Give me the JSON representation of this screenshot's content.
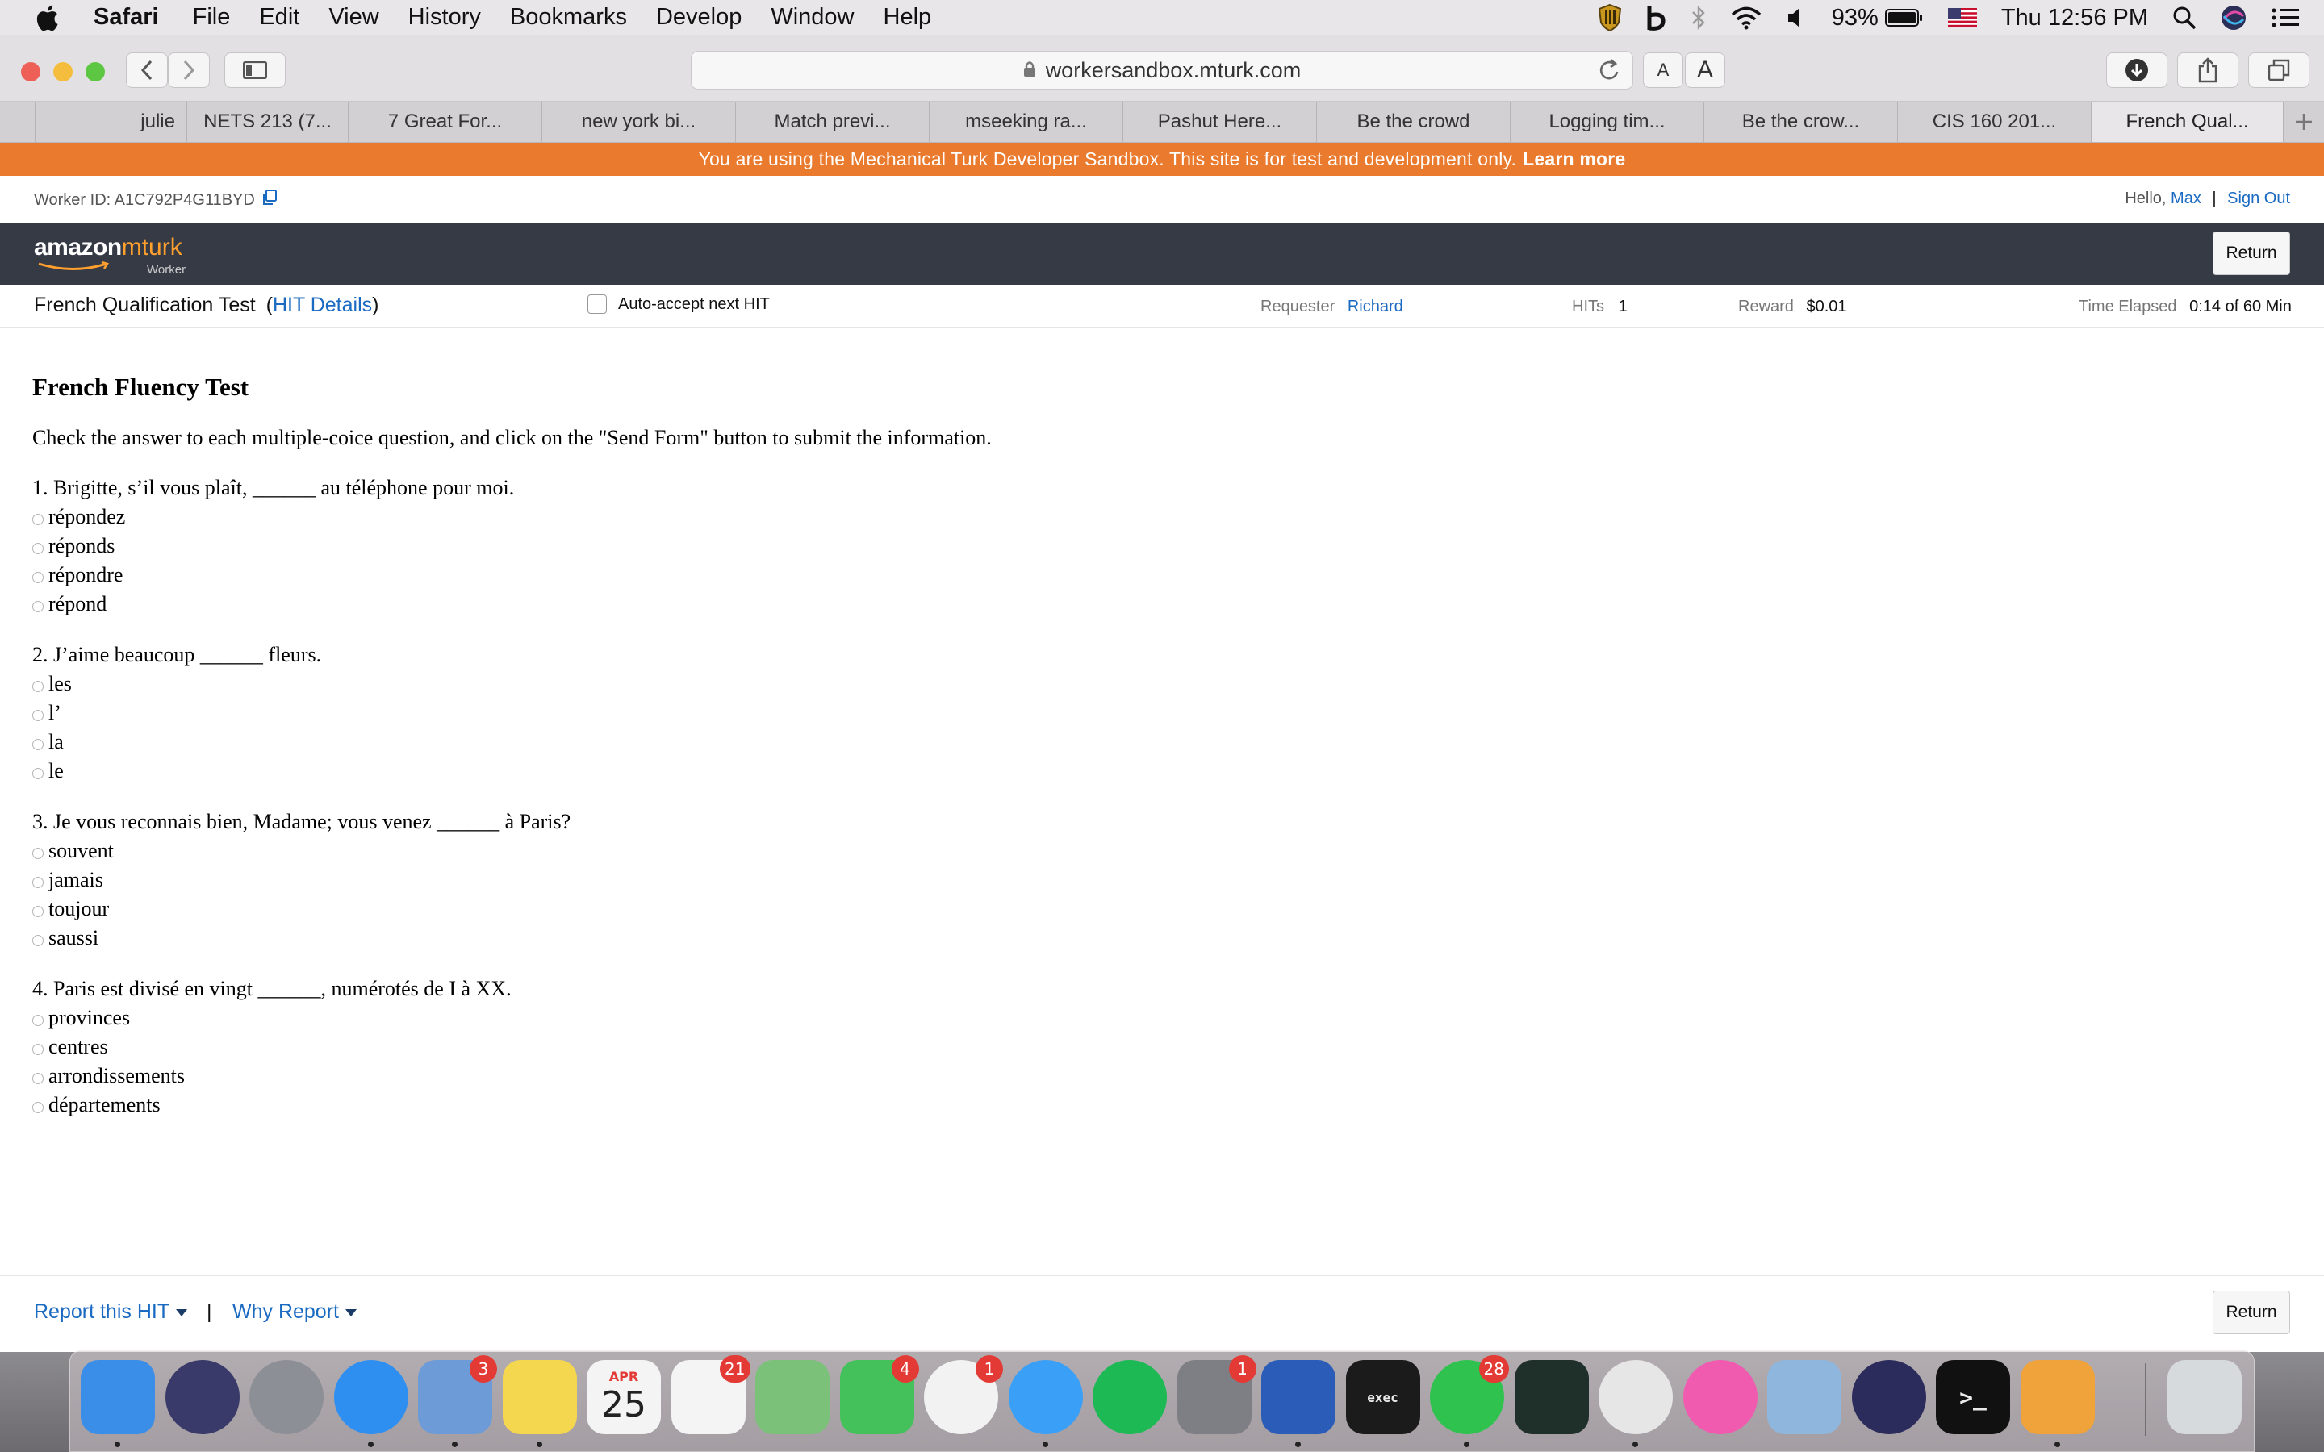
{
  "menubar": {
    "app_name": "Safari",
    "items": [
      "File",
      "Edit",
      "View",
      "History",
      "Bookmarks",
      "Develop",
      "Window",
      "Help"
    ],
    "battery": "93%",
    "clock": "Thu 12:56 PM"
  },
  "toolbar": {
    "url": "workersandbox.mturk.com",
    "font_small": "A",
    "font_large": "A"
  },
  "tabs": [
    {
      "label": "julie"
    },
    {
      "label": "NETS 213 (7..."
    },
    {
      "label": "7 Great For..."
    },
    {
      "label": "new york bi..."
    },
    {
      "label": "Match previ..."
    },
    {
      "label": "mseeking ra..."
    },
    {
      "label": "Pashut Here..."
    },
    {
      "label": "Be the crowd"
    },
    {
      "label": "Logging tim..."
    },
    {
      "label": "Be the crow..."
    },
    {
      "label": "CIS 160 201..."
    },
    {
      "label": "French Qual..."
    }
  ],
  "sandbox_banner": {
    "text": "You are using the Mechanical Turk Developer Sandbox. This site is for test and development only.",
    "link": "Learn more"
  },
  "worker_row": {
    "worker_id": "Worker ID: A1C792P4G11BYD",
    "hello": "Hello,",
    "user": "Max",
    "divider": "|",
    "sign_out": "Sign Out"
  },
  "header": {
    "logo_amazon": "amazon",
    "logo_mturk": "mturk",
    "logo_worker": "Worker",
    "return_label": "Return"
  },
  "hit_bar": {
    "title": "French Qualification Test",
    "details_open": "(",
    "details_link": "HIT Details",
    "details_close": ")",
    "auto_accept": "Auto-accept next HIT",
    "requester_label": "Requester",
    "requester_value": "Richard",
    "hits_label": "HITs",
    "hits_value": "1",
    "reward_label": "Reward",
    "reward_value": "$0.01",
    "time_label": "Time Elapsed",
    "time_value": "0:14 of 60 Min"
  },
  "form": {
    "title": "French Fluency Test",
    "instructions": "Check the answer to each multiple-coice question, and click on the \"Send Form\" button to submit the information.",
    "questions": [
      {
        "text": "1. Brigitte, s’il vous plaît, ______ au téléphone pour moi.",
        "options": [
          "répondez",
          "réponds",
          "répondre",
          "répond"
        ]
      },
      {
        "text": "2. J’aime beaucoup ______ fleurs.",
        "options": [
          "les",
          "l’",
          "la",
          "le"
        ]
      },
      {
        "text": "3. Je vous reconnais bien, Madame; vous venez ______ à Paris?",
        "options": [
          "souvent",
          "jamais",
          "toujour",
          "saussi"
        ]
      },
      {
        "text": "4. Paris est divisé en vingt ______, numérotés de I à XX.",
        "options": [
          "provinces",
          "centres",
          "arrondissements",
          "départements"
        ]
      }
    ]
  },
  "footer": {
    "report_label": "Report this HIT",
    "separator": "|",
    "why_label": "Why Report",
    "return_label": "Return"
  },
  "dock": {
    "icons": [
      {
        "name": "finder-icon",
        "color": "#3b8ee8"
      },
      {
        "name": "siri-icon",
        "color": "#3a3a6a"
      },
      {
        "name": "launchpad-icon",
        "color": "#8d8f96"
      },
      {
        "name": "safari-icon",
        "color": "#2f8ff0"
      },
      {
        "name": "mail-icon",
        "color": "#6d9bd8",
        "badge": "3"
      },
      {
        "name": "notes-icon",
        "color": "#f5d64f"
      },
      {
        "name": "calendar-icon",
        "color": "#f4f4f4",
        "month": "APR",
        "day": "25"
      },
      {
        "name": "reminders-icon",
        "color": "#f4f4f4",
        "badge": "21"
      },
      {
        "name": "maps-icon",
        "color": "#7cc17a"
      },
      {
        "name": "facetime-icon",
        "color": "#44c15a",
        "badge": "4"
      },
      {
        "name": "photos-icon",
        "color": "#f2f2f2",
        "badge": "1"
      },
      {
        "name": "messages-icon",
        "color": "#3aa0f7"
      },
      {
        "name": "spotify-icon",
        "color": "#1db954"
      },
      {
        "name": "system-preferences-icon",
        "color": "#7d7f85",
        "badge": "1"
      },
      {
        "name": "word-icon",
        "color": "#2b5cb8"
      },
      {
        "name": "terminal-exec-icon",
        "color": "#1b1b1b",
        "label": "exec"
      },
      {
        "name": "whatsapp-icon",
        "color": "#30c24f",
        "badge": "28"
      },
      {
        "name": "activity-monitor-icon",
        "color": "#1f2f2a"
      },
      {
        "name": "chrome-icon",
        "color": "#e6e6e6"
      },
      {
        "name": "itunes-icon",
        "color": "#f05bb0"
      },
      {
        "name": "preview-icon",
        "color": "#8fb6dd"
      },
      {
        "name": "eclipse-icon",
        "color": "#2c2c5c"
      },
      {
        "name": "terminal-icon",
        "color": "#111111",
        "label": ">_"
      },
      {
        "name": "pages-icon",
        "color": "#f0a23b"
      },
      {
        "name": "trash-icon",
        "color": "#d7dadd"
      }
    ]
  },
  "colors": {
    "sandbox_banner": "#ea7a2d",
    "mturk_header": "#353a45",
    "link": "#1a6ac2",
    "accent_orange": "#ff9f2e"
  }
}
